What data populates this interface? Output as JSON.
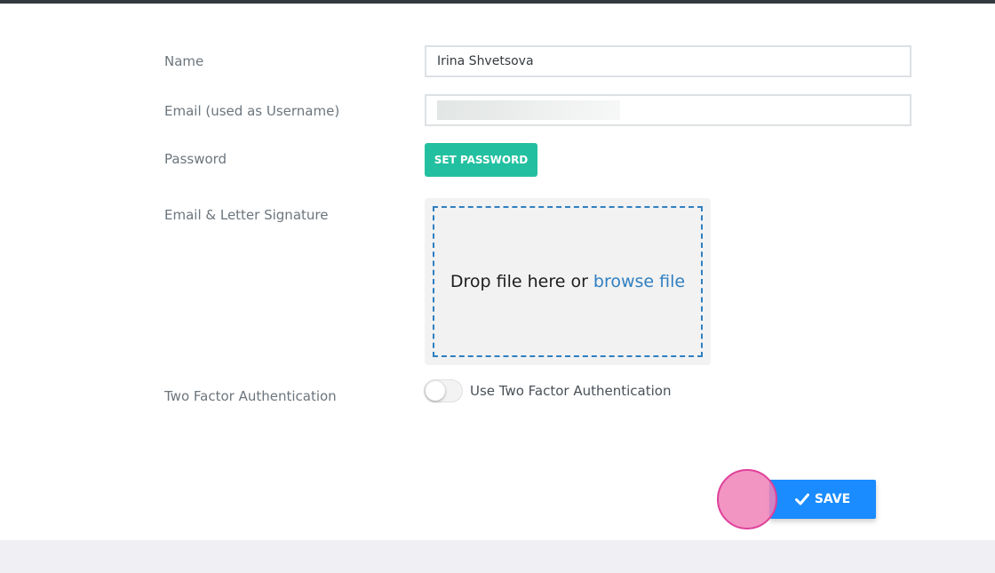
{
  "form": {
    "name_label": "Name",
    "name_value": "Irina Shvetsova",
    "email_label": "Email (used as Username)",
    "email_value": "",
    "password_label": "Password",
    "set_password_button": "SET PASSWORD",
    "signature_label": "Email & Letter Signature",
    "dropzone_text": "Drop file here or",
    "dropzone_link": "browse file",
    "two_factor_label": "Two Factor Authentication",
    "two_factor_toggle_label": "Use Two Factor Authentication",
    "two_factor_enabled": false
  },
  "actions": {
    "save_label": "SAVE"
  },
  "colors": {
    "set_password_bg": "#22c0a0",
    "save_bg": "#1a8cff",
    "link": "#2f7fc1"
  }
}
